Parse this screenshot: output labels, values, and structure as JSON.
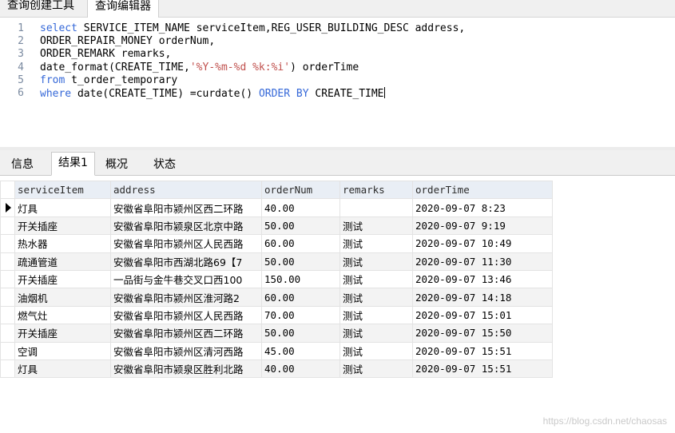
{
  "top_tabs": [
    "查询创建工具",
    "查询编辑器"
  ],
  "editor": {
    "lines": [
      {
        "num": "1",
        "parts": [
          {
            "t": "select",
            "k": "kw"
          },
          {
            "t": " SERVICE_ITEM_NAME serviceItem,REG_USER_BUILDING_DESC address,",
            "k": ""
          }
        ]
      },
      {
        "num": "2",
        "parts": [
          {
            "t": "ORDER_REPAIR_MONEY orderNum,",
            "k": ""
          }
        ]
      },
      {
        "num": "3",
        "parts": [
          {
            "t": "ORDER_REMARK remarks,",
            "k": ""
          }
        ]
      },
      {
        "num": "4",
        "parts": [
          {
            "t": "date_format(CREATE_TIME,",
            "k": ""
          },
          {
            "t": "'%Y-%m-%d %k:%i'",
            "k": "str"
          },
          {
            "t": ") orderTime",
            "k": ""
          }
        ]
      },
      {
        "num": "5",
        "parts": [
          {
            "t": "from",
            "k": "kw"
          },
          {
            "t": " t_order_temporary",
            "k": ""
          }
        ]
      },
      {
        "num": "6",
        "parts": [
          {
            "t": "where",
            "k": "kw"
          },
          {
            "t": " date(CREATE_TIME) =curdate() ",
            "k": ""
          },
          {
            "t": "ORDER BY",
            "k": "kw"
          },
          {
            "t": " CREATE_TIME",
            "k": ""
          }
        ]
      }
    ]
  },
  "result_tabs": [
    "信息",
    "结果1",
    "概况",
    "状态"
  ],
  "active_result_tab": 1,
  "grid": {
    "columns": [
      "serviceItem",
      "address",
      "orderNum",
      "remarks",
      "orderTime"
    ],
    "rows": [
      [
        "灯具",
        "安徽省阜阳市颍州区西二环路",
        "40.00",
        "",
        "2020-09-07 8:23"
      ],
      [
        "开关插座",
        "安徽省阜阳市颍泉区北京中路",
        "50.00",
        "测试",
        "2020-09-07 9:19"
      ],
      [
        "热水器",
        "安徽省阜阳市颍州区人民西路",
        "60.00",
        "测试",
        "2020-09-07 10:49"
      ],
      [
        "疏通管道",
        "安徽省阜阳市西湖北路69【7",
        "50.00",
        "测试",
        "2020-09-07 11:30"
      ],
      [
        "开关插座",
        "一品街与金牛巷交叉口西100",
        "150.00",
        "测试",
        "2020-09-07 13:46"
      ],
      [
        "油烟机",
        "安徽省阜阳市颍州区淮河路2",
        "60.00",
        "测试",
        "2020-09-07 14:18"
      ],
      [
        "燃气灶",
        "安徽省阜阳市颍州区人民西路",
        "70.00",
        "测试",
        "2020-09-07 15:01"
      ],
      [
        "开关插座",
        "安徽省阜阳市颍州区西二环路",
        "50.00",
        "测试",
        "2020-09-07 15:50"
      ],
      [
        "空调",
        "安徽省阜阳市颍州区清河西路",
        "45.00",
        "测试",
        "2020-09-07 15:51"
      ],
      [
        "灯具",
        "安徽省阜阳市颍泉区胜利北路",
        "40.00",
        "测试",
        "2020-09-07 15:51"
      ]
    ]
  },
  "watermark": "https://blog.csdn.net/chaosas"
}
